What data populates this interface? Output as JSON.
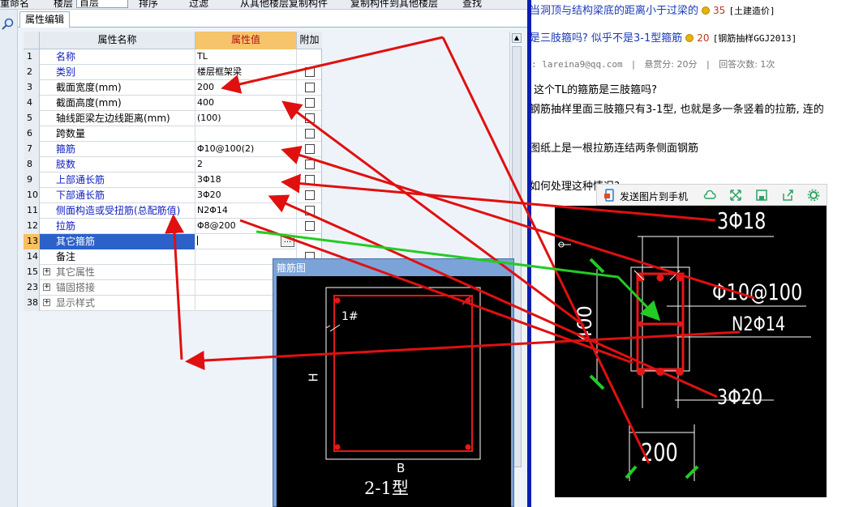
{
  "toolbar": {
    "rename": "重命名",
    "floor_label": "楼层",
    "floor_value": "首层",
    "sort": "排序",
    "filter": "过滤",
    "copy_from_other": "从其他楼层复制构件",
    "copy_to_other": "复制构件到其他楼层",
    "find": "查找"
  },
  "tab": "属性编辑",
  "grid": {
    "col_name": "属性名称",
    "col_value": "属性值",
    "col_add": "附加",
    "rows": [
      {
        "num": "1",
        "name": "名称",
        "value": "TL",
        "checkbox": false
      },
      {
        "num": "2",
        "name": "类别",
        "value": "楼层框架梁",
        "checkbox": true
      },
      {
        "num": "3",
        "name": "截面宽度(mm)",
        "value": "200",
        "checkbox": true
      },
      {
        "num": "4",
        "name": "截面高度(mm)",
        "value": "400",
        "checkbox": true
      },
      {
        "num": "5",
        "name": "轴线距梁左边线距离(mm)",
        "value": "(100)",
        "checkbox": true
      },
      {
        "num": "6",
        "name": "跨数量",
        "value": "",
        "checkbox": true
      },
      {
        "num": "7",
        "name": "箍筋",
        "value": "Φ10@100(2)",
        "checkbox": true
      },
      {
        "num": "8",
        "name": "肢数",
        "value": "2",
        "checkbox": true
      },
      {
        "num": "9",
        "name": "上部通长筋",
        "value": "3Φ18",
        "checkbox": true
      },
      {
        "num": "10",
        "name": "下部通长筋",
        "value": "3Φ20",
        "checkbox": true
      },
      {
        "num": "11",
        "name": "侧面构造或受扭筋(总配筋值)",
        "value": "N2Φ14",
        "checkbox": true
      },
      {
        "num": "12",
        "name": "拉筋",
        "value": "Φ8@200",
        "checkbox": true
      },
      {
        "num": "13",
        "name": "其它箍筋",
        "value": "",
        "checkbox": false
      },
      {
        "num": "14",
        "name": "备注",
        "value": "",
        "checkbox": true
      },
      {
        "num": "15",
        "name": "其它属性",
        "value": "",
        "checkbox": false
      },
      {
        "num": "23",
        "name": "锚固搭接",
        "value": "",
        "checkbox": false
      },
      {
        "num": "38",
        "name": "显示样式",
        "value": "",
        "checkbox": false
      }
    ],
    "ellipsis": "..."
  },
  "stirrup_window": {
    "title": "箍筋图",
    "label_h": "H",
    "label_b": "B",
    "label_1": "1#",
    "type_label": "2-1型"
  },
  "qa": {
    "item1_title": "当洞顶与结构梁底的距离小于过梁的",
    "item1_score": "35",
    "item1_cat": "[土建造价]",
    "item2_title": "是三肢箍吗? 似乎不是3-1型箍筋",
    "item2_score": "20",
    "item2_cat": "[钢筋抽样GGJ2013]",
    "meta_email": ": lareina9@qq.com",
    "meta_sep": "|",
    "meta_reward": "悬赏分: 20分",
    "meta_answers": "回答次数: 1次",
    "q_line1": "这个TL的箍筋是三肢箍吗?",
    "q_line2": "钢筋抽样里面三肢箍只有3-1型, 也就是多一条竖着的拉筋, 连的",
    "q_line3": "图纸上是一根拉筋连结两条侧面钢筋",
    "q_line4": "如何处理这种情况?"
  },
  "cad_toolbar": {
    "send_to_phone": "发送图片到手机"
  },
  "cad": {
    "top_bars": "3Φ18",
    "stirrup": "Φ10@100",
    "side_bars": "N2Φ14",
    "bottom_bars": "3Φ20",
    "height": "400",
    "width": "200"
  },
  "colors": {
    "link": "#1a3bb8",
    "selected": "#2b61c9",
    "annotation_red": "#e01010",
    "annotation_green": "#22cc22"
  }
}
